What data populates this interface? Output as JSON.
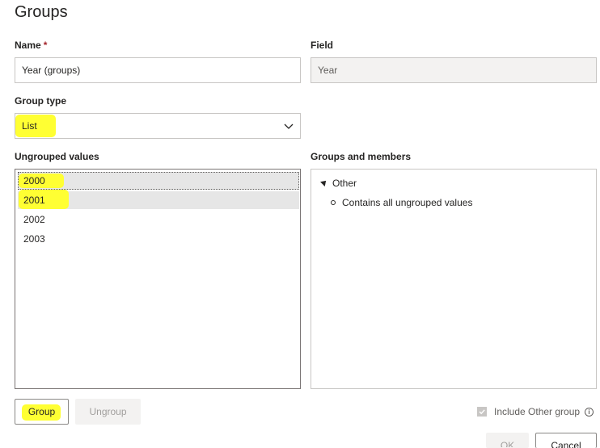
{
  "dialog": {
    "title": "Groups"
  },
  "name_field": {
    "label": "Name",
    "required_mark": "*",
    "value": "Year (groups)"
  },
  "field_field": {
    "label": "Field",
    "value": "Year"
  },
  "group_type": {
    "label": "Group type",
    "value": "List",
    "icon": "chevron-down-icon"
  },
  "ungrouped": {
    "label": "Ungrouped values",
    "items": [
      {
        "label": "2000",
        "selected": true,
        "highlighted": true
      },
      {
        "label": "2001",
        "selected": true,
        "highlighted": true
      },
      {
        "label": "2002",
        "selected": false,
        "highlighted": false
      },
      {
        "label": "2003",
        "selected": false,
        "highlighted": false
      }
    ]
  },
  "groups_members": {
    "label": "Groups and members",
    "groups": [
      {
        "name": "Other",
        "expanded": true,
        "members": [
          "Contains all ungrouped values"
        ]
      }
    ]
  },
  "buttons": {
    "group": "Group",
    "ungroup": "Ungroup",
    "ok": "OK",
    "cancel": "Cancel"
  },
  "include_other": {
    "label": "Include Other group",
    "checked": true,
    "disabled": true,
    "info_icon": "info-icon"
  },
  "colors": {
    "highlight": "#ffff33",
    "selection": "#e6e6e6",
    "readonly_bg": "#f3f2f1"
  }
}
